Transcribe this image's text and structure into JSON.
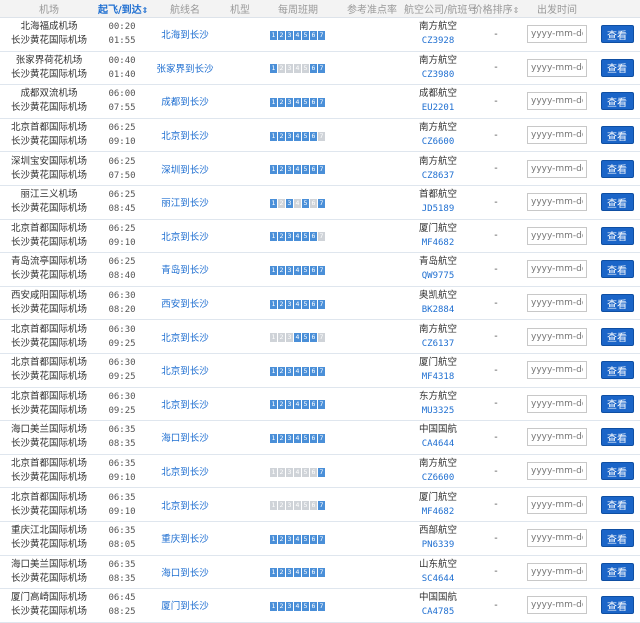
{
  "headers": {
    "airport": "机场",
    "time": "起飞/到达",
    "route": "航线名",
    "model": "机型",
    "schedule": "每周班期",
    "ontime": "参考准点率",
    "airline": "航空公司/航班号",
    "price": "价格排序",
    "date": "出发时间"
  },
  "date_placeholder": "yyyy-mm-dd",
  "view_label": "查看",
  "flights": [
    {
      "dep": "北海福成机场",
      "arr": "长沙黄花国际机场",
      "dt": "00:20",
      "at": "01:55",
      "route": "北海到长沙",
      "days": [
        1,
        1,
        1,
        1,
        1,
        1,
        1
      ],
      "airline": "南方航空",
      "no": "CZ3928",
      "price": "-"
    },
    {
      "dep": "张家界荷花机场",
      "arr": "长沙黄花国际机场",
      "dt": "00:40",
      "at": "01:40",
      "route": "张家界到长沙",
      "days": [
        1,
        0,
        0,
        0,
        0,
        1,
        1
      ],
      "airline": "南方航空",
      "no": "CZ3980",
      "price": "-"
    },
    {
      "dep": "成都双流机场",
      "arr": "长沙黄花国际机场",
      "dt": "06:00",
      "at": "07:55",
      "route": "成都到长沙",
      "days": [
        1,
        1,
        1,
        1,
        1,
        1,
        1
      ],
      "airline": "成都航空",
      "no": "EU2201",
      "price": "-"
    },
    {
      "dep": "北京首都国际机场",
      "arr": "长沙黄花国际机场",
      "dt": "06:25",
      "at": "09:10",
      "route": "北京到长沙",
      "days": [
        1,
        1,
        1,
        1,
        1,
        1,
        0
      ],
      "airline": "南方航空",
      "no": "CZ6600",
      "price": "-"
    },
    {
      "dep": "深圳宝安国际机场",
      "arr": "长沙黄花国际机场",
      "dt": "06:25",
      "at": "07:50",
      "route": "深圳到长沙",
      "days": [
        1,
        1,
        1,
        1,
        1,
        1,
        1
      ],
      "airline": "南方航空",
      "no": "CZ8637",
      "price": "-"
    },
    {
      "dep": "丽江三义机场",
      "arr": "长沙黄花国际机场",
      "dt": "06:25",
      "at": "08:45",
      "route": "丽江到长沙",
      "days": [
        1,
        0,
        1,
        0,
        1,
        0,
        1
      ],
      "airline": "首都航空",
      "no": "JD5189",
      "price": "-"
    },
    {
      "dep": "北京首都国际机场",
      "arr": "长沙黄花国际机场",
      "dt": "06:25",
      "at": "09:10",
      "route": "北京到长沙",
      "days": [
        1,
        1,
        1,
        1,
        1,
        1,
        0
      ],
      "airline": "厦门航空",
      "no": "MF4682",
      "price": "-"
    },
    {
      "dep": "青岛流亭国际机场",
      "arr": "长沙黄花国际机场",
      "dt": "06:25",
      "at": "08:40",
      "route": "青岛到长沙",
      "days": [
        1,
        1,
        1,
        1,
        1,
        1,
        1
      ],
      "airline": "青岛航空",
      "no": "QW9775",
      "price": "-"
    },
    {
      "dep": "西安咸阳国际机场",
      "arr": "长沙黄花国际机场",
      "dt": "06:30",
      "at": "08:20",
      "route": "西安到长沙",
      "days": [
        1,
        1,
        1,
        1,
        1,
        1,
        1
      ],
      "airline": "奥凯航空",
      "no": "BK2884",
      "price": "-"
    },
    {
      "dep": "北京首都国际机场",
      "arr": "长沙黄花国际机场",
      "dt": "06:30",
      "at": "09:25",
      "route": "北京到长沙",
      "days": [
        0,
        0,
        0,
        1,
        1,
        1,
        0
      ],
      "airline": "南方航空",
      "no": "CZ6137",
      "price": "-"
    },
    {
      "dep": "北京首都国际机场",
      "arr": "长沙黄花国际机场",
      "dt": "06:30",
      "at": "09:25",
      "route": "北京到长沙",
      "days": [
        1,
        1,
        1,
        1,
        1,
        1,
        1
      ],
      "airline": "厦门航空",
      "no": "MF4318",
      "price": "-"
    },
    {
      "dep": "北京首都国际机场",
      "arr": "长沙黄花国际机场",
      "dt": "06:30",
      "at": "09:25",
      "route": "北京到长沙",
      "days": [
        1,
        1,
        1,
        1,
        1,
        1,
        1
      ],
      "airline": "东方航空",
      "no": "MU3325",
      "price": "-"
    },
    {
      "dep": "海口美兰国际机场",
      "arr": "长沙黄花国际机场",
      "dt": "06:35",
      "at": "08:35",
      "route": "海口到长沙",
      "days": [
        1,
        1,
        1,
        1,
        1,
        1,
        1
      ],
      "airline": "中国国航",
      "no": "CA4644",
      "price": "-"
    },
    {
      "dep": "北京首都国际机场",
      "arr": "长沙黄花国际机场",
      "dt": "06:35",
      "at": "09:10",
      "route": "北京到长沙",
      "days": [
        0,
        0,
        0,
        0,
        0,
        0,
        1
      ],
      "airline": "南方航空",
      "no": "CZ6600",
      "price": "-"
    },
    {
      "dep": "北京首都国际机场",
      "arr": "长沙黄花国际机场",
      "dt": "06:35",
      "at": "09:10",
      "route": "北京到长沙",
      "days": [
        0,
        0,
        0,
        0,
        0,
        0,
        1
      ],
      "airline": "厦门航空",
      "no": "MF4682",
      "price": "-"
    },
    {
      "dep": "重庆江北国际机场",
      "arr": "长沙黄花国际机场",
      "dt": "06:35",
      "at": "08:05",
      "route": "重庆到长沙",
      "days": [
        1,
        1,
        1,
        1,
        1,
        1,
        1
      ],
      "airline": "西部航空",
      "no": "PN6339",
      "price": "-"
    },
    {
      "dep": "海口美兰国际机场",
      "arr": "长沙黄花国际机场",
      "dt": "06:35",
      "at": "08:35",
      "route": "海口到长沙",
      "days": [
        1,
        1,
        1,
        1,
        1,
        1,
        1
      ],
      "airline": "山东航空",
      "no": "SC4644",
      "price": "-"
    },
    {
      "dep": "厦门高崎国际机场",
      "arr": "长沙黄花国际机场",
      "dt": "06:45",
      "at": "08:25",
      "route": "厦门到长沙",
      "days": [
        1,
        1,
        1,
        1,
        1,
        1,
        1
      ],
      "airline": "中国国航",
      "no": "CA4785",
      "price": "-"
    }
  ]
}
